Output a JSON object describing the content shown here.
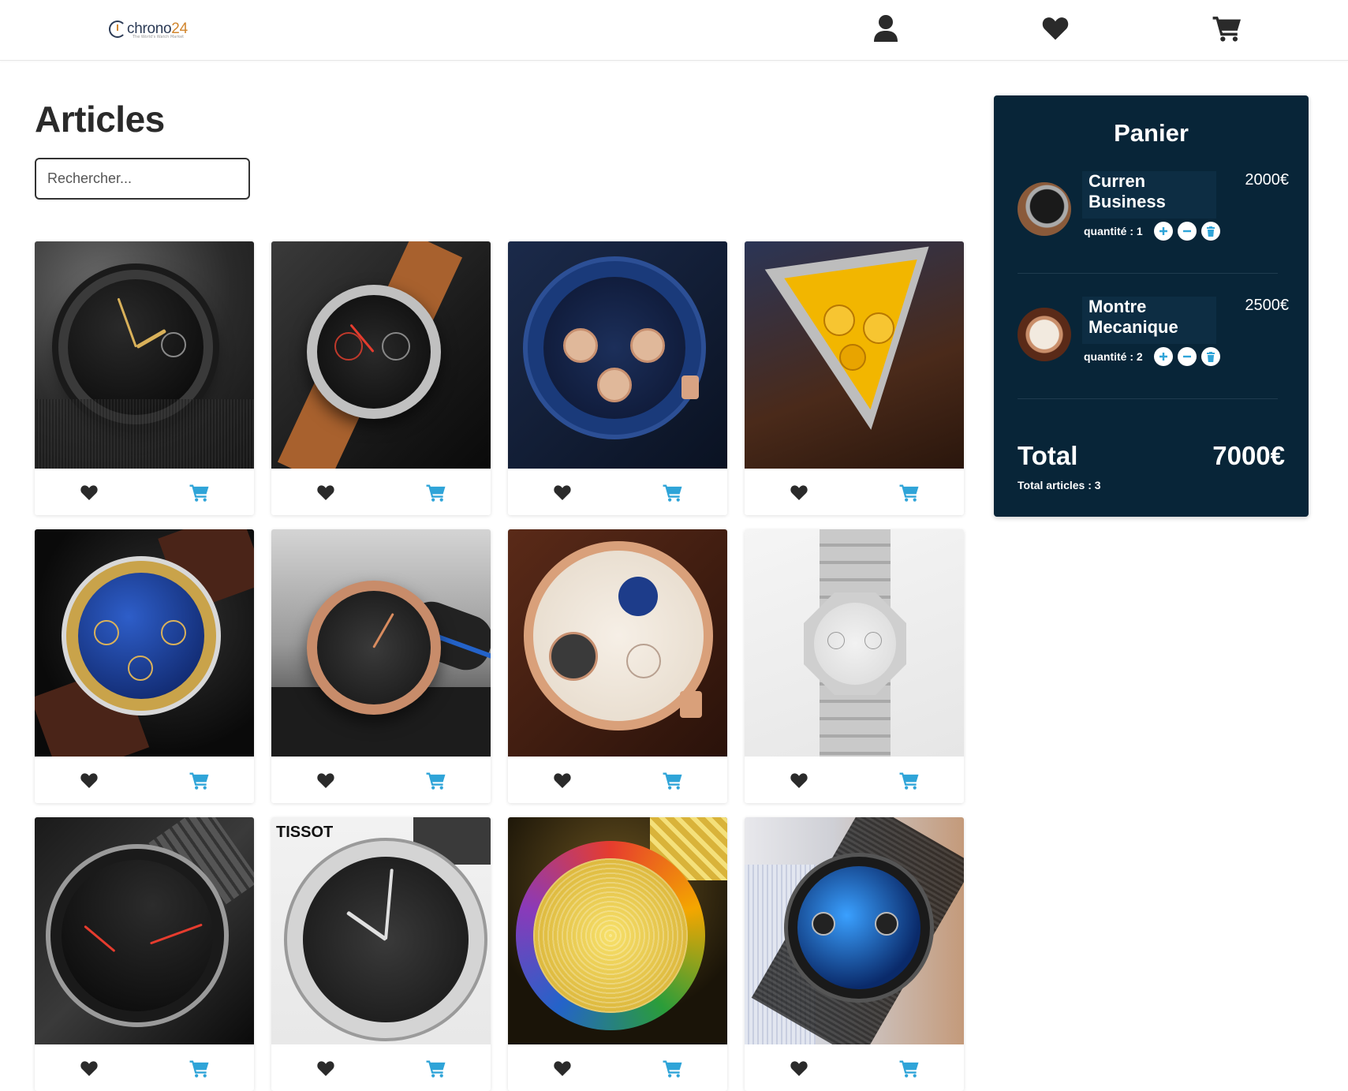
{
  "header": {
    "logo_text": "chrono",
    "logo_number": "24",
    "logo_tagline": "The World's Watch Market",
    "icons": [
      "user-icon",
      "heart-icon",
      "cart-icon"
    ]
  },
  "main": {
    "title": "Articles",
    "search_placeholder": "Rechercher..."
  },
  "products": [
    {
      "id": 1,
      "dial": "black-gold",
      "icons": [
        "heart-icon",
        "cart-icon"
      ]
    },
    {
      "id": 2,
      "dial": "black-red-leather",
      "icons": [
        "heart-icon",
        "cart-icon"
      ]
    },
    {
      "id": 3,
      "dial": "blue-rosegold",
      "icons": [
        "heart-icon",
        "cart-icon"
      ]
    },
    {
      "id": 4,
      "dial": "yellow-triangle",
      "icons": [
        "heart-icon",
        "cart-icon"
      ]
    },
    {
      "id": 5,
      "dial": "blue-gold-leather",
      "icons": [
        "heart-icon",
        "cart-icon"
      ]
    },
    {
      "id": 6,
      "dial": "black-rose-rubber",
      "icons": [
        "heart-icon",
        "cart-icon"
      ]
    },
    {
      "id": 7,
      "dial": "white-skeleton-moon",
      "icons": [
        "heart-icon",
        "cart-icon"
      ]
    },
    {
      "id": 8,
      "dial": "silver-octagon",
      "icons": [
        "heart-icon",
        "cart-icon"
      ]
    },
    {
      "id": 9,
      "dial": "black-red-minimal",
      "icons": [
        "heart-icon",
        "cart-icon"
      ]
    },
    {
      "id": 10,
      "dial": "tissot-black-steel",
      "icons": [
        "heart-icon",
        "cart-icon"
      ]
    },
    {
      "id": 11,
      "dial": "gold-diamond",
      "icons": [
        "heart-icon",
        "cart-icon"
      ]
    },
    {
      "id": 12,
      "dial": "blue-geneva-mesh",
      "icons": [
        "heart-icon",
        "cart-icon"
      ]
    }
  ],
  "cart": {
    "title": "Panier",
    "items": [
      {
        "name_line1": "Curren",
        "name_line2": "Business",
        "price": "2000€",
        "quantity_label": "quantité : 1"
      },
      {
        "name_line1": "Montre",
        "name_line2": "Mecanique",
        "price": "2500€",
        "quantity_label": "quantité : 2"
      }
    ],
    "total_label": "Total",
    "total_value": "7000€",
    "total_articles": "Total articles : 3"
  },
  "colors": {
    "cart_bg": "#082538",
    "accent_blue": "#2fa4d8",
    "icon_dark": "#2a2a2a"
  }
}
